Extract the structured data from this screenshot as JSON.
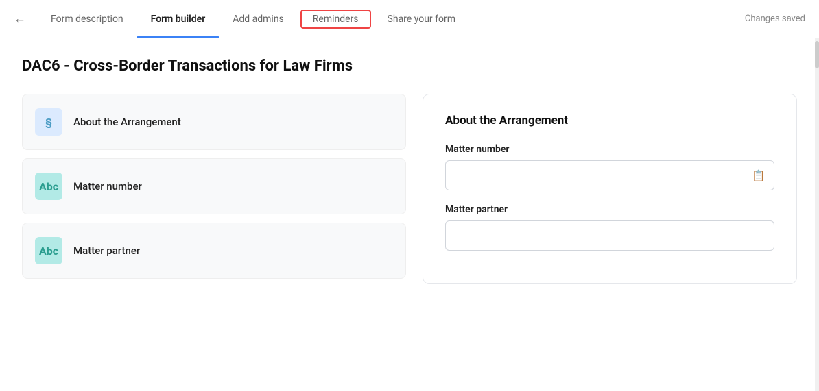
{
  "nav": {
    "back_label": "←",
    "tabs": [
      {
        "id": "form-description",
        "label": "Form description",
        "active": false,
        "highlighted": false
      },
      {
        "id": "form-builder",
        "label": "Form builder",
        "active": true,
        "highlighted": false
      },
      {
        "id": "add-admins",
        "label": "Add admins",
        "active": false,
        "highlighted": false
      },
      {
        "id": "reminders",
        "label": "Reminders",
        "active": false,
        "highlighted": true
      },
      {
        "id": "share-your-form",
        "label": "Share your form",
        "active": false,
        "highlighted": false
      }
    ],
    "status": "Changes saved"
  },
  "page": {
    "title": "DAC6 - Cross-Border Transactions for Law Firms"
  },
  "left_items": [
    {
      "id": "about-the-arrangement",
      "icon_text": "§",
      "icon_style": "blue",
      "label": "About the Arrangement"
    },
    {
      "id": "matter-number",
      "icon_text": "Abc",
      "icon_style": "teal",
      "label": "Matter number"
    },
    {
      "id": "matter-partner",
      "icon_text": "Abc",
      "icon_style": "teal",
      "label": "Matter partner"
    }
  ],
  "preview": {
    "section_title": "About the Arrangement",
    "fields": [
      {
        "id": "matter-number",
        "label": "Matter number",
        "placeholder": "",
        "has_icon": true,
        "icon": "📋"
      },
      {
        "id": "matter-partner",
        "label": "Matter partner",
        "placeholder": "",
        "has_icon": false
      }
    ]
  }
}
